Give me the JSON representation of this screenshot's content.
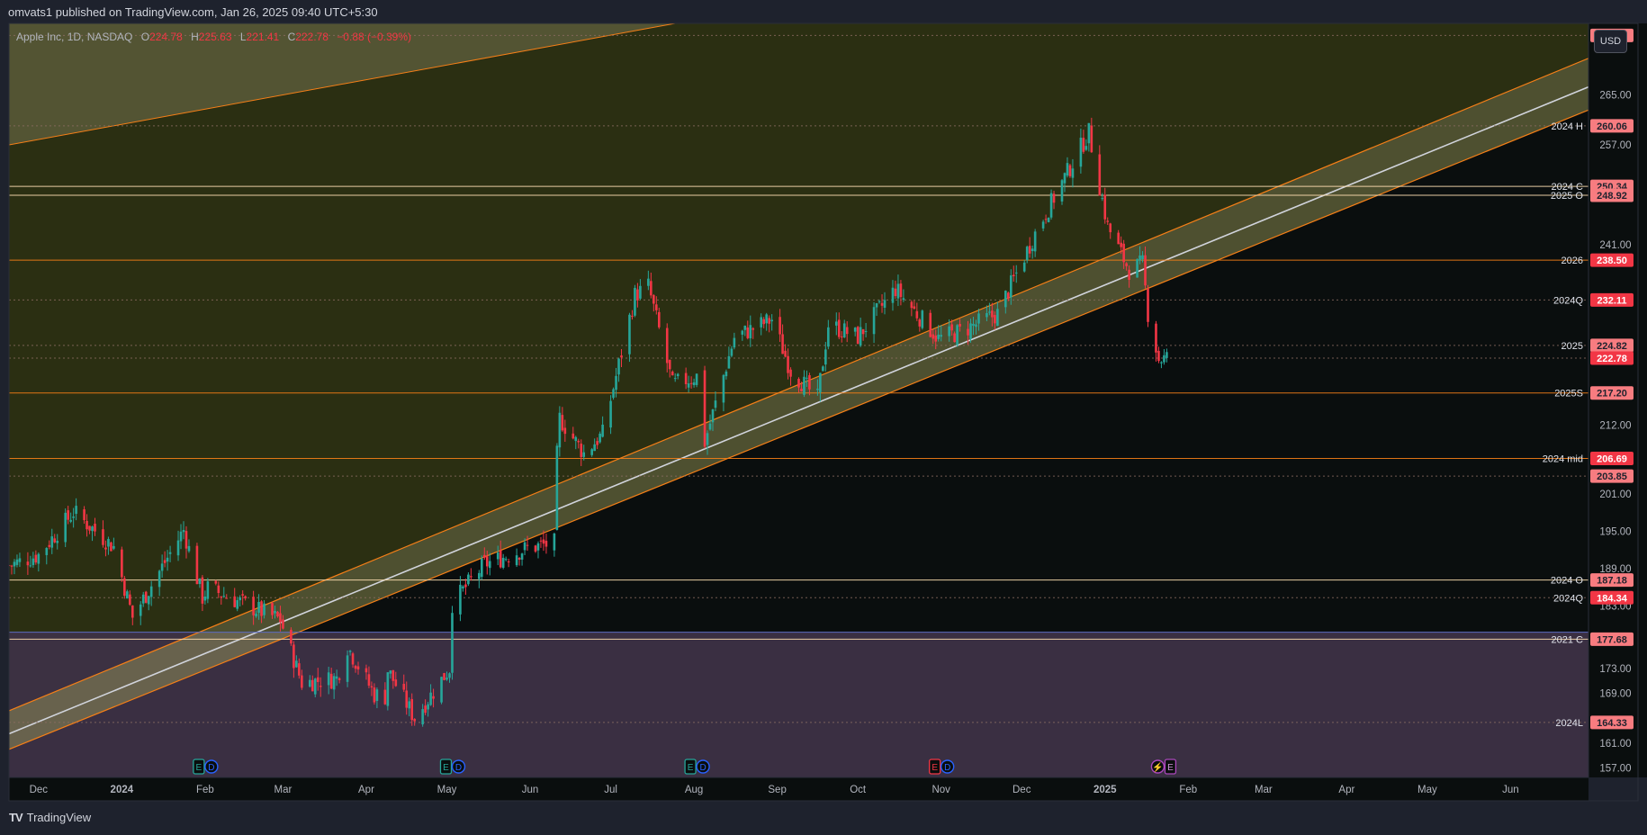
{
  "header": {
    "publish_text": "omvats1 published on TradingView.com, Jan 26, 2025 09:40 UTC+5:30",
    "symbol_text": "Apple Inc, 1D, NASDAQ",
    "ohlc": [
      {
        "key": "O",
        "value": "224.78"
      },
      {
        "key": "H",
        "value": "225.63"
      },
      {
        "key": "L",
        "value": "221.41"
      },
      {
        "key": "C",
        "value": "222.78"
      }
    ],
    "change_text": "−0.88 (−0.39%)",
    "currency_button": "USD"
  },
  "brand": {
    "logo_glyph": "TV",
    "text": "TradingView"
  },
  "colors": {
    "background": "#0a0e0e",
    "frame": "#1e222d",
    "up": "#26a69a",
    "down": "#f23645",
    "upper_zone": "#2b2f12",
    "lower_zone": "#3d3246",
    "channel_fill": "#a1a15a",
    "channel_edge": "#f57f17",
    "level_label_bg": "#f77c80",
    "level_label_bg_strong": "#f23645"
  },
  "chart_data": {
    "type": "candlestick",
    "title": "Apple Inc, 1D, NASDAQ",
    "currency": "USD",
    "ylim": [
      155.5,
      276.5
    ],
    "y_ticks": [
      "265.00",
      "257.00",
      "241.00",
      "212.00",
      "201.00",
      "195.00",
      "189.00",
      "183.00",
      "173.00",
      "169.00",
      "161.00",
      "157.00"
    ],
    "x_range": [
      "2023-11-20",
      "2025-06-30"
    ],
    "x_ticks": [
      {
        "label": "Dec",
        "date": "2023-12-01"
      },
      {
        "label": "2024",
        "date": "2024-01-01"
      },
      {
        "label": "Feb",
        "date": "2024-02-01"
      },
      {
        "label": "Mar",
        "date": "2024-03-01"
      },
      {
        "label": "Apr",
        "date": "2024-04-01"
      },
      {
        "label": "May",
        "date": "2024-05-01"
      },
      {
        "label": "Jun",
        "date": "2024-06-01"
      },
      {
        "label": "Jul",
        "date": "2024-07-01"
      },
      {
        "label": "Aug",
        "date": "2024-08-01"
      },
      {
        "label": "Sep",
        "date": "2024-09-01"
      },
      {
        "label": "Oct",
        "date": "2024-10-01"
      },
      {
        "label": "Nov",
        "date": "2024-11-01"
      },
      {
        "label": "Dec",
        "date": "2024-12-01"
      },
      {
        "label": "2025",
        "date": "2025-01-01"
      },
      {
        "label": "Feb",
        "date": "2025-02-01"
      },
      {
        "label": "Mar",
        "date": "2025-03-01"
      },
      {
        "label": "Apr",
        "date": "2025-04-01"
      },
      {
        "label": "May",
        "date": "2025-05-01"
      },
      {
        "label": "Jun",
        "date": "2025-06-01"
      }
    ],
    "price_path": [
      [
        "2023-11-20",
        189.5
      ],
      [
        "2023-12-01",
        191.2
      ],
      [
        "2023-12-14",
        198.1
      ],
      [
        "2023-12-29",
        192.5
      ],
      [
        "2024-01-05",
        181.2
      ],
      [
        "2024-01-19",
        191.5
      ],
      [
        "2024-01-24",
        195.2
      ],
      [
        "2024-01-31",
        184.4
      ],
      [
        "2024-02-02",
        185.9
      ],
      [
        "2024-02-29",
        180.8
      ],
      [
        "2024-03-08",
        170.7
      ],
      [
        "2024-03-21",
        171.4
      ],
      [
        "2024-03-25",
        176.5
      ],
      [
        "2024-04-04",
        168.8
      ],
      [
        "2024-04-08",
        168.5
      ],
      [
        "2024-04-09",
        172.7
      ],
      [
        "2024-04-19",
        165.0
      ],
      [
        "2024-04-26",
        169.3
      ],
      [
        "2024-05-02",
        173.0
      ],
      [
        "2024-05-03",
        183.4
      ],
      [
        "2024-05-15",
        189.7
      ],
      [
        "2024-05-31",
        192.3
      ],
      [
        "2024-06-10",
        193.1
      ],
      [
        "2024-06-11",
        207.2
      ],
      [
        "2024-06-12",
        213.1
      ],
      [
        "2024-06-21",
        207.5
      ],
      [
        "2024-06-28",
        210.6
      ],
      [
        "2024-07-10",
        232.9
      ],
      [
        "2024-07-15",
        234.4
      ],
      [
        "2024-07-24",
        218.5
      ],
      [
        "2024-08-02",
        219.9
      ],
      [
        "2024-08-05",
        209.3
      ],
      [
        "2024-08-16",
        226.1
      ],
      [
        "2024-08-30",
        229.0
      ],
      [
        "2024-09-06",
        220.8
      ],
      [
        "2024-09-16",
        216.3
      ],
      [
        "2024-09-20",
        228.2
      ],
      [
        "2024-10-01",
        226.2
      ],
      [
        "2024-10-15",
        233.9
      ],
      [
        "2024-10-31",
        225.9
      ],
      [
        "2024-11-08",
        227.0
      ],
      [
        "2024-11-22",
        229.9
      ],
      [
        "2024-12-06",
        242.8
      ],
      [
        "2024-12-16",
        251.0
      ],
      [
        "2024-12-26",
        259.0
      ],
      [
        "2025-01-02",
        243.9
      ],
      [
        "2025-01-10",
        236.9
      ],
      [
        "2025-01-15",
        237.9
      ],
      [
        "2025-01-17",
        229.98
      ],
      [
        "2025-01-21",
        222.6
      ],
      [
        "2025-01-24",
        222.78
      ]
    ],
    "levels": [
      {
        "name": "",
        "value": 274.57
      },
      {
        "name": "2024 H",
        "value": 260.06
      },
      {
        "name": "2024 C",
        "value": 250.34
      },
      {
        "name": "2025 O",
        "value": 248.92
      },
      {
        "name": "2026",
        "value": 238.5
      },
      {
        "name": "2024Q",
        "value": 232.11
      },
      {
        "name": "2025",
        "value": 224.82
      },
      {
        "name": "",
        "value": 222.78
      },
      {
        "name": "2025S",
        "value": 217.2
      },
      {
        "name": "2024 mid",
        "value": 206.69
      },
      {
        "name": "",
        "value": 203.85
      },
      {
        "name": "2024 O",
        "value": 187.18
      },
      {
        "name": "2024Q",
        "value": 184.34
      },
      {
        "name": "2021 C",
        "value": 177.68
      },
      {
        "name": "2024L",
        "value": 164.33
      }
    ],
    "channel": {
      "start_date": "2023-11-20",
      "end_date": "2025-06-30",
      "upper_start": 166.2,
      "upper_end": 270.9,
      "mid_start": 162.5,
      "mid_end": 266.3,
      "lower_start": 160.0,
      "lower_end": 262.6
    },
    "upper_band": {
      "start_date": "2023-11-20",
      "end_date": "2024-07-25",
      "start_value": 257.0,
      "end_value": 276.5
    },
    "zone_split": 178.8,
    "events": [
      {
        "date": "2024-02-01",
        "markers": [
          "E",
          "D"
        ]
      },
      {
        "date": "2024-05-03",
        "markers": [
          "E",
          "D"
        ]
      },
      {
        "date": "2024-08-02",
        "markers": [
          "E",
          "D"
        ]
      },
      {
        "date": "2024-11-01",
        "markers": [
          "E",
          "D"
        ]
      },
      {
        "date": "2025-01-23",
        "markers": [
          "⚡",
          "E"
        ]
      }
    ]
  }
}
